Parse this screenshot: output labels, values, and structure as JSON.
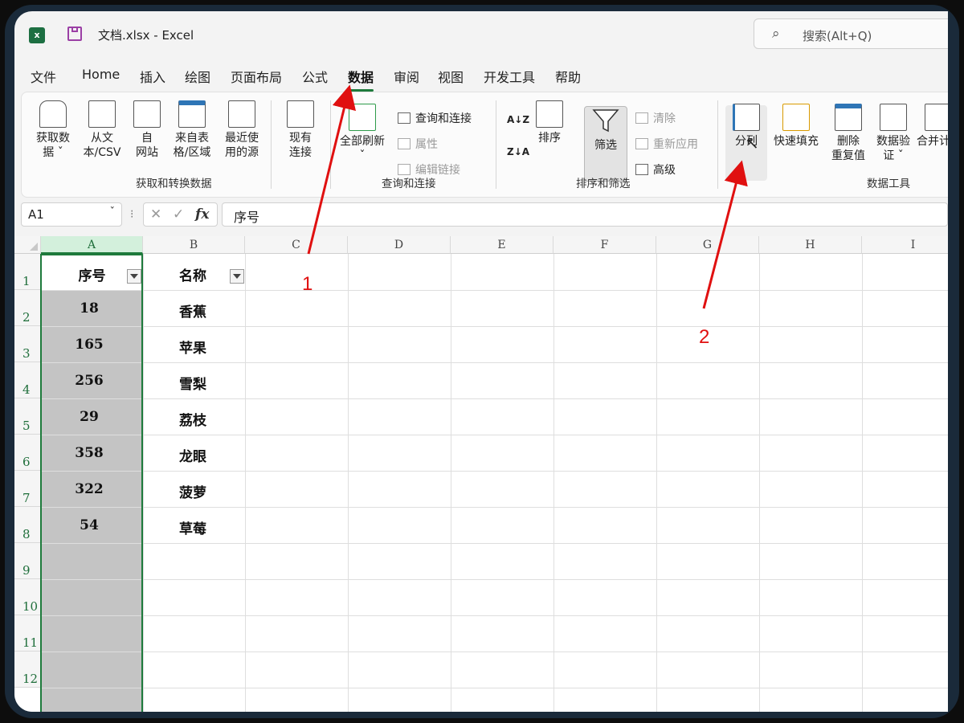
{
  "titlebar": {
    "app_icon": "x",
    "title": "文档.xlsx  -  Excel",
    "search_placeholder": "搜索(Alt+Q)"
  },
  "menu": [
    {
      "label": "文件",
      "active": false
    },
    {
      "label": "Home",
      "active": false
    },
    {
      "label": "插入",
      "active": false
    },
    {
      "label": "绘图",
      "active": false
    },
    {
      "label": "页面布局",
      "active": false
    },
    {
      "label": "公式",
      "active": false
    },
    {
      "label": "数据",
      "active": true
    },
    {
      "label": "审阅",
      "active": false
    },
    {
      "label": "视图",
      "active": false
    },
    {
      "label": "开发工具",
      "active": false
    },
    {
      "label": "帮助",
      "active": false
    }
  ],
  "ribbon": {
    "get_data": {
      "line1": "获取数",
      "line2": "据 ˇ"
    },
    "from_csv": {
      "line1": "从文",
      "line2": "本/CSV"
    },
    "from_web": {
      "line1": "自",
      "line2": "网站"
    },
    "from_table": {
      "line1": "来自表",
      "line2": "格/区域"
    },
    "recent_sources": {
      "line1": "最近使",
      "line2": "用的源"
    },
    "existing_conn": {
      "line1": "现有",
      "line2": "连接"
    },
    "group1_label": "获取和转换数据",
    "refresh_all": {
      "line1": "全部刷新",
      "line2": "ˇ"
    },
    "queries_conn": "查询和连接",
    "properties": "属性",
    "edit_links": "编辑链接",
    "group2_label": "查询和连接",
    "sort_az": "A↓Z",
    "sort_za": "Z↓A",
    "sort": "排序",
    "filter": "筛选",
    "clear": "清除",
    "reapply": "重新应用",
    "advanced": "高级",
    "group3_label": "排序和筛选",
    "text_to_columns": "分列",
    "flash_fill": "快速填充",
    "remove_dup": {
      "line1": "删除",
      "line2": "重复值"
    },
    "data_validation": {
      "line1": "数据验",
      "line2": "证 ˇ"
    },
    "consolidate": "合并计",
    "group4_label": "数据工具"
  },
  "formula_bar": {
    "name_box": "A1",
    "dropdown": "ˇ",
    "sep": "⁝",
    "cancel": "✕",
    "enter": "✓",
    "fx": "fx",
    "content": "序号"
  },
  "columns": [
    "A",
    "B",
    "C",
    "D",
    "E",
    "F",
    "G",
    "H",
    "I"
  ],
  "rows": [
    "1",
    "2",
    "3",
    "4",
    "5",
    "6",
    "7",
    "8",
    "9",
    "10",
    "11",
    "12"
  ],
  "table": {
    "header_a": "序号",
    "header_b": "名称",
    "col_a": [
      "18",
      "165",
      "256",
      "29",
      "358",
      "322",
      "54"
    ],
    "col_b": [
      "香蕉",
      "苹果",
      "雪梨",
      "荔枝",
      "龙眼",
      "菠萝",
      "草莓"
    ]
  },
  "annotations": {
    "label1": "1",
    "label2": "2",
    "color": "#e01010"
  },
  "colors": {
    "accent": "#1e7a3c",
    "selection_fill": "#c4c4c4"
  }
}
